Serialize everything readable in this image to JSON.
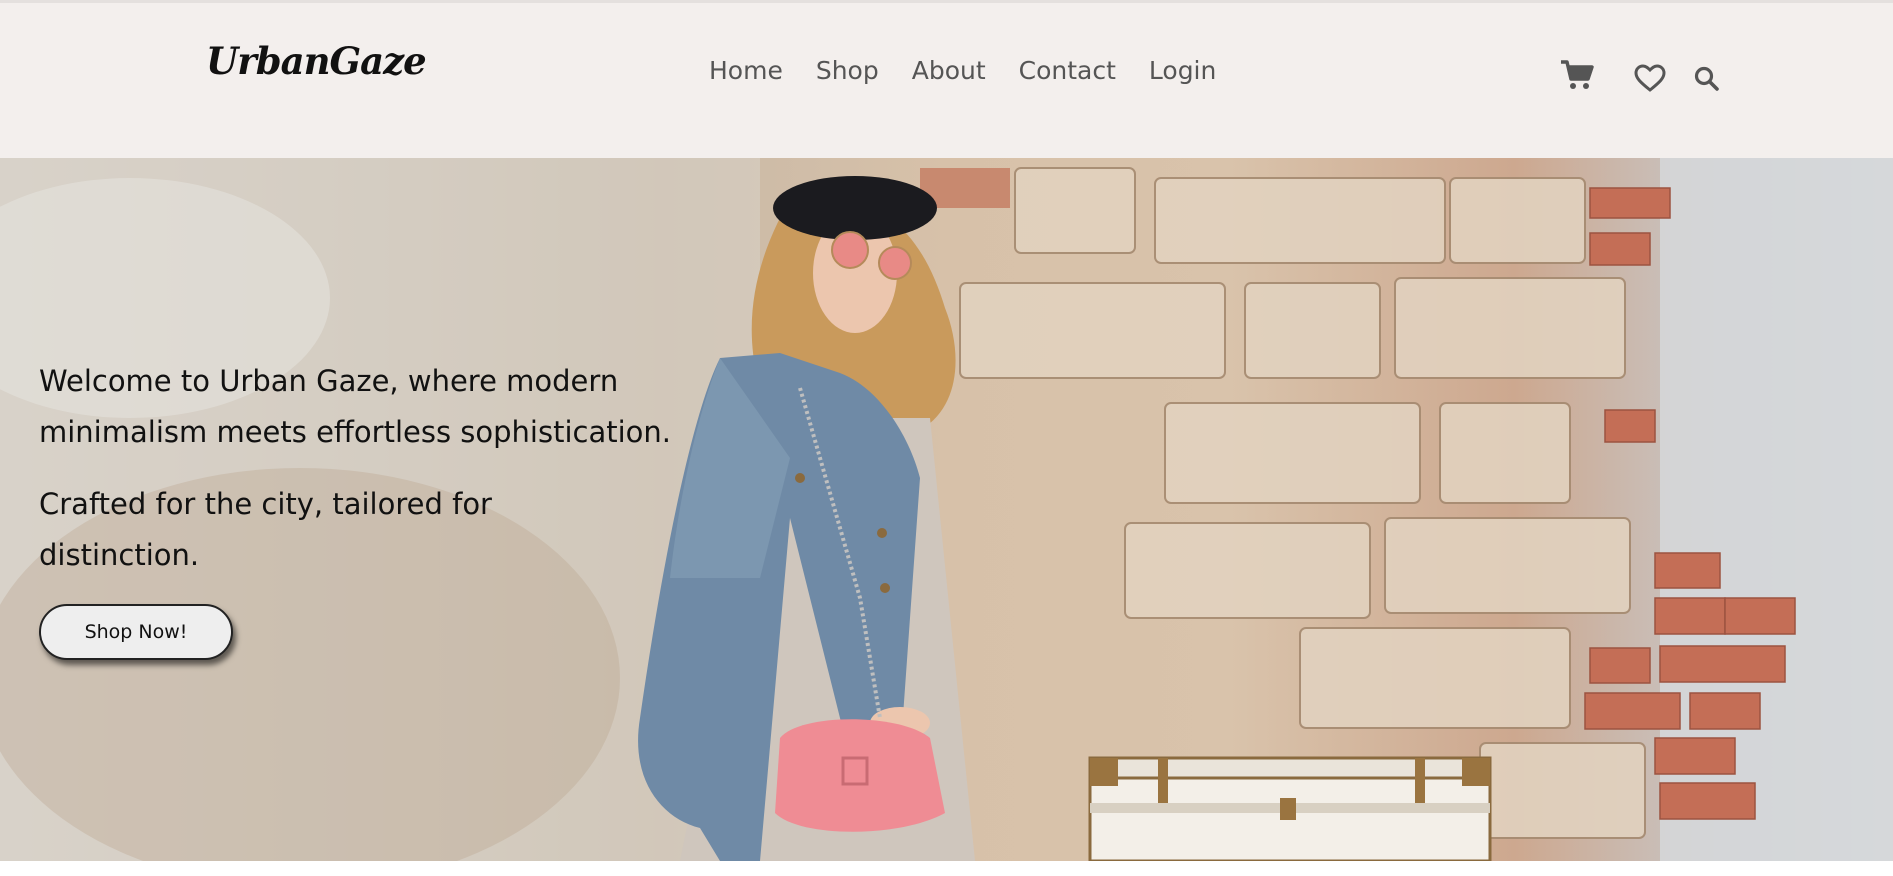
{
  "header": {
    "logo": "UrbanGaze",
    "nav": [
      "Home",
      "Shop",
      "About",
      "Contact",
      "Login"
    ],
    "icons": [
      "cart-icon",
      "heart-icon",
      "search-icon"
    ]
  },
  "hero": {
    "headline": "Welcome to Urban Gaze, where modern minimalism meets effortless sophistication.",
    "subline": "Crafted for the city, tailored for distinction.",
    "cta_label": "Shop Now!"
  },
  "colors": {
    "header_bg": "#f3efed",
    "nav_text": "#555555",
    "text": "#111111",
    "button_bg": "#eeeeee"
  }
}
